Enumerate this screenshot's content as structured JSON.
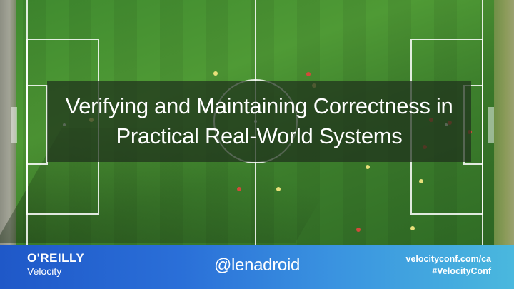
{
  "slide": {
    "title_line1": "Verifying and Maintaining Correctness in",
    "title_line2": "Practical Real-World Systems"
  },
  "footer": {
    "brand": "O'REILLY",
    "brand_sub": "Velocity",
    "handle": "@lenadroid",
    "url": "velocityconf.com/ca",
    "hashtag": "#VelocityConf"
  },
  "colors": {
    "pitch_green": "#3f8a2f",
    "overlay": "#1e301c",
    "bar_start": "#1f58c8",
    "bar_end": "#4ab8de"
  }
}
